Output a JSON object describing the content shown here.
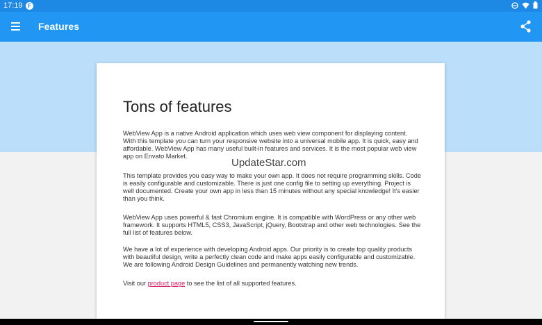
{
  "status_bar": {
    "time": "17:19",
    "app_badge": "F"
  },
  "appbar": {
    "title": "Features",
    "menu_icon": "hamburger-menu-icon",
    "share_icon": "share-icon"
  },
  "colors": {
    "appbar": "#2196f3",
    "statusbar": "#1e88e5",
    "hero": "#bbdefb",
    "link": "#d81b60"
  },
  "card": {
    "title": "Tons of features",
    "p1": "WebView App is a native Android application which uses web view component for displaying content. With this template you can turn your responsive website into a universal mobile app. It is quick, easy and affordable. WebView App has many useful built-in features and services. It is the most popular web view app on Envato Market.",
    "p2": "This template provides you easy way to make your own app. It does not require programming skills. Code is easily configurable and customizable. There is just one config file to setting up everything. Project is well documented. Create your own app in less than 15 minutes without any special knowledge! It's easier than you think.",
    "p3": "WebView App uses powerful & fast Chromium engine. It is compatible with WordPress or any other web framework. It supports HTML5, CSS3, JavaScript, jQuery, Bootstrap and other web technologies. See the full list of features below.",
    "p4": "We have a lot of experience with developing Android apps. Our priority is to create top quality products with beautiful design, write a perfectly clean code and make apps easily configurable and customizable. We are following Android Design Guidelines and permanently watching new trends.",
    "p5_prefix": "Visit our",
    "p5_link": "product page",
    "p5_suffix": "to see the list of all supported features."
  },
  "watermark": "UpdateStar.com"
}
